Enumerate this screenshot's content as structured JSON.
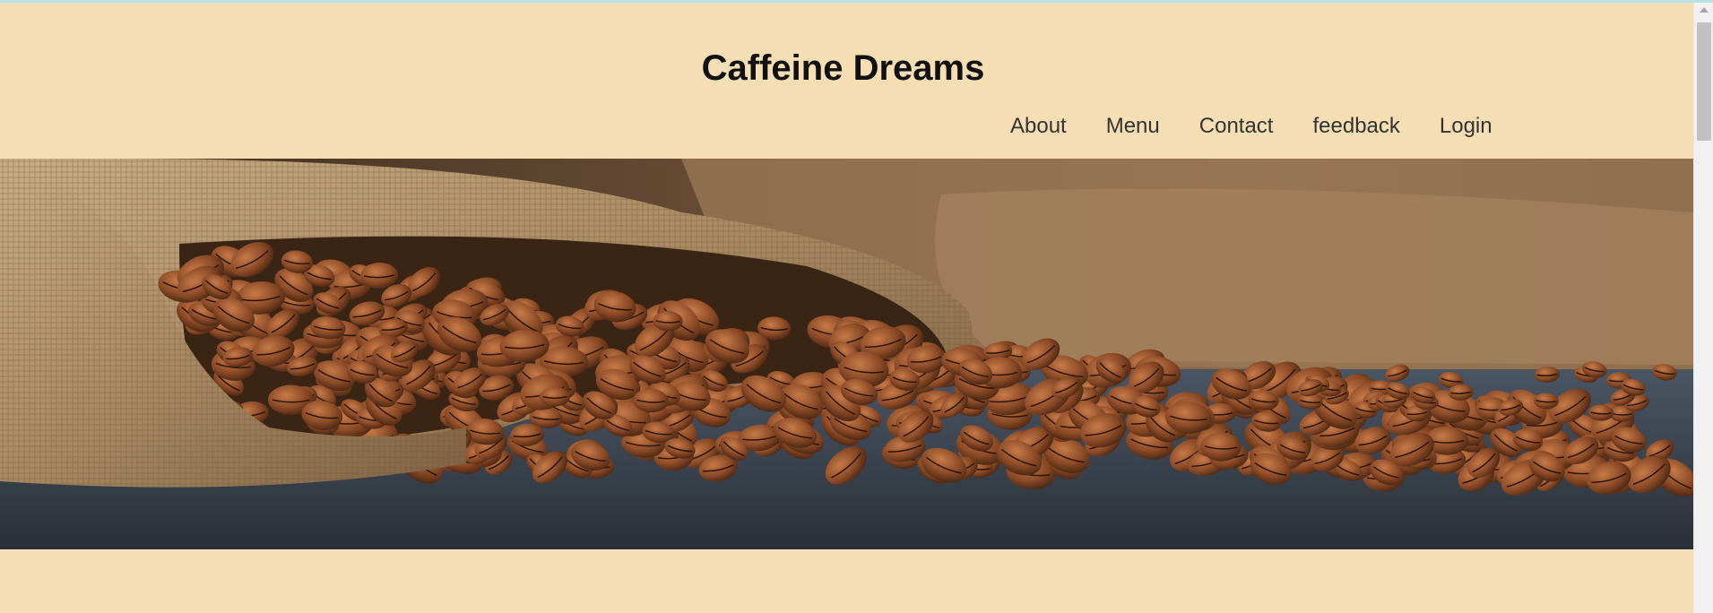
{
  "site": {
    "title": "Caffeine Dreams"
  },
  "nav": {
    "items": [
      {
        "label": "About"
      },
      {
        "label": "Menu"
      },
      {
        "label": "Contact"
      },
      {
        "label": "feedback"
      },
      {
        "label": "Login"
      }
    ]
  },
  "hero": {
    "image_icon": "coffee-beans-burlap-sack-image"
  },
  "colors": {
    "page_background": "#f5deb3",
    "accent_strip": "#b8e1e6",
    "text": "#111111"
  }
}
